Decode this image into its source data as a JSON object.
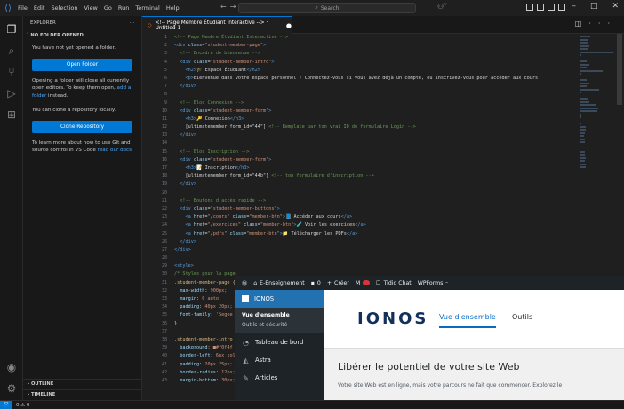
{
  "titlebar": {
    "menus": [
      "File",
      "Edit",
      "Selection",
      "View",
      "Go",
      "Run",
      "Terminal",
      "Help"
    ],
    "search_placeholder": "Search"
  },
  "sidebar": {
    "title": "EXPLORER",
    "section": "NO FOLDER OPENED",
    "no_folder_text": "You have not yet opened a folder.",
    "open_folder_button": "Open Folder",
    "info_text": "Opening a folder will close all currently open editors. To keep them open,",
    "info_link": "add a folder",
    "info_suffix": "instead.",
    "clone_text": "You can clone a repository locally.",
    "clone_button": "Clone Repository",
    "learn_text": "To learn more about how to use Git and source control in VS Code",
    "learn_link": "read our docs",
    "outline": "OUTLINE",
    "timeline": "TIMELINE"
  },
  "status": {
    "problems": "0 ⚠ 0"
  },
  "editor": {
    "tab_title": "<!-- Page Membre Étudiant Interactive --> · Untitled-1",
    "line_numbers": [
      "1",
      "2",
      "3",
      "4",
      "5",
      "6",
      "7",
      "8",
      "9",
      "10",
      "11",
      "12",
      "13",
      "14",
      "15",
      "16",
      "17",
      "18",
      "19",
      "20",
      "21",
      "22",
      "23",
      "24",
      "25",
      "26",
      "27",
      "28",
      "29",
      "30",
      "31",
      "32",
      "33",
      "34",
      "35",
      "36",
      "37",
      "38",
      "39",
      "40",
      "41",
      "42",
      "43"
    ],
    "lines": [
      {
        "parts": [
          {
            "c": "c-com",
            "t": "<!-- Page Membre Étudiant Interactive -->"
          }
        ]
      },
      {
        "parts": [
          {
            "c": "c-tag",
            "t": "<div "
          },
          {
            "c": "c-attr",
            "t": "class"
          },
          {
            "c": "c-txt",
            "t": "="
          },
          {
            "c": "c-str",
            "t": "\"student-member-page\""
          },
          {
            "c": "c-tag",
            "t": ">"
          }
        ]
      },
      {
        "parts": [
          {
            "c": "c-com",
            "t": "  <!-- Encadré de bienvenue -->"
          }
        ]
      },
      {
        "parts": [
          {
            "c": "c-tag",
            "t": "  <div "
          },
          {
            "c": "c-attr",
            "t": "class"
          },
          {
            "c": "c-txt",
            "t": "="
          },
          {
            "c": "c-str",
            "t": "\"student-member-intro\""
          },
          {
            "c": "c-tag",
            "t": ">"
          }
        ]
      },
      {
        "parts": [
          {
            "c": "c-tag",
            "t": "    <h2>"
          },
          {
            "c": "c-txt",
            "t": "🎓 Espace Étudiant"
          },
          {
            "c": "c-tag",
            "t": "</h2>"
          }
        ]
      },
      {
        "parts": [
          {
            "c": "c-tag",
            "t": "    <p>"
          },
          {
            "c": "c-txt",
            "t": "Bienvenue dans votre espace personnel ! Connectez-vous si vous avez déjà un compte, ou inscrivez-vous pour accéder aux cours"
          }
        ]
      },
      {
        "parts": [
          {
            "c": "c-tag",
            "t": "  </div>"
          }
        ]
      },
      {
        "parts": [
          {
            "c": "c-txt",
            "t": ""
          }
        ]
      },
      {
        "parts": [
          {
            "c": "c-com",
            "t": "  <!-- Bloc Connexion -->"
          }
        ]
      },
      {
        "parts": [
          {
            "c": "c-tag",
            "t": "  <div "
          },
          {
            "c": "c-attr",
            "t": "class"
          },
          {
            "c": "c-txt",
            "t": "="
          },
          {
            "c": "c-str",
            "t": "\"student-member-form\""
          },
          {
            "c": "c-tag",
            "t": ">"
          }
        ]
      },
      {
        "parts": [
          {
            "c": "c-tag",
            "t": "    <h3>"
          },
          {
            "c": "c-txt",
            "t": "🔑 Connexion"
          },
          {
            "c": "c-tag",
            "t": "</h3>"
          }
        ]
      },
      {
        "parts": [
          {
            "c": "c-txt",
            "t": "    [ultimatemember form_id=\"44\"] "
          },
          {
            "c": "c-com",
            "t": "<!-- Remplace par ton vrai ID de formulaire Login -->"
          }
        ]
      },
      {
        "parts": [
          {
            "c": "c-tag",
            "t": "  </div>"
          }
        ]
      },
      {
        "parts": [
          {
            "c": "c-txt",
            "t": ""
          }
        ]
      },
      {
        "parts": [
          {
            "c": "c-com",
            "t": "  <!-- Bloc Inscription -->"
          }
        ]
      },
      {
        "parts": [
          {
            "c": "c-tag",
            "t": "  <div "
          },
          {
            "c": "c-attr",
            "t": "class"
          },
          {
            "c": "c-txt",
            "t": "="
          },
          {
            "c": "c-str",
            "t": "\"student-member-form\""
          },
          {
            "c": "c-tag",
            "t": ">"
          }
        ]
      },
      {
        "parts": [
          {
            "c": "c-tag",
            "t": "    <h3>"
          },
          {
            "c": "c-txt",
            "t": "📝 Inscription"
          },
          {
            "c": "c-tag",
            "t": "</h3>"
          }
        ]
      },
      {
        "parts": [
          {
            "c": "c-txt",
            "t": "    [ultimatemember form_id=\"44b\"] "
          },
          {
            "c": "c-com",
            "t": "<!-- ton formulaire d'inscription -->"
          }
        ]
      },
      {
        "parts": [
          {
            "c": "c-tag",
            "t": "  </div>"
          }
        ]
      },
      {
        "parts": [
          {
            "c": "c-txt",
            "t": ""
          }
        ]
      },
      {
        "parts": [
          {
            "c": "c-com",
            "t": "  <!-- Boutons d'accès rapide -->"
          }
        ]
      },
      {
        "parts": [
          {
            "c": "c-tag",
            "t": "  <div "
          },
          {
            "c": "c-attr",
            "t": "class"
          },
          {
            "c": "c-txt",
            "t": "="
          },
          {
            "c": "c-str",
            "t": "\"student-member-buttons\""
          },
          {
            "c": "c-tag",
            "t": ">"
          }
        ]
      },
      {
        "parts": [
          {
            "c": "c-tag",
            "t": "    <a "
          },
          {
            "c": "c-attr",
            "t": "href"
          },
          {
            "c": "c-txt",
            "t": "="
          },
          {
            "c": "c-str",
            "t": "\"/cours\" "
          },
          {
            "c": "c-attr",
            "t": "class"
          },
          {
            "c": "c-txt",
            "t": "="
          },
          {
            "c": "c-str",
            "t": "\"member-btn\""
          },
          {
            "c": "c-tag",
            "t": ">"
          },
          {
            "c": "c-txt",
            "t": "📘 Accéder aux cours"
          },
          {
            "c": "c-tag",
            "t": "</a>"
          }
        ]
      },
      {
        "parts": [
          {
            "c": "c-tag",
            "t": "    <a "
          },
          {
            "c": "c-attr",
            "t": "href"
          },
          {
            "c": "c-txt",
            "t": "="
          },
          {
            "c": "c-str",
            "t": "\"/exercices\" "
          },
          {
            "c": "c-attr",
            "t": "class"
          },
          {
            "c": "c-txt",
            "t": "="
          },
          {
            "c": "c-str",
            "t": "\"member-btn\""
          },
          {
            "c": "c-tag",
            "t": ">"
          },
          {
            "c": "c-txt",
            "t": "🧪 Voir les exercices"
          },
          {
            "c": "c-tag",
            "t": "</a>"
          }
        ]
      },
      {
        "parts": [
          {
            "c": "c-tag",
            "t": "    <a "
          },
          {
            "c": "c-attr",
            "t": "href"
          },
          {
            "c": "c-txt",
            "t": "="
          },
          {
            "c": "c-str",
            "t": "\"/pdfs\" "
          },
          {
            "c": "c-attr",
            "t": "class"
          },
          {
            "c": "c-txt",
            "t": "="
          },
          {
            "c": "c-str",
            "t": "\"member-btn\""
          },
          {
            "c": "c-tag",
            "t": ">"
          },
          {
            "c": "c-txt",
            "t": "📁 Télécharger les PDFs"
          },
          {
            "c": "c-tag",
            "t": "</a>"
          }
        ]
      },
      {
        "parts": [
          {
            "c": "c-tag",
            "t": "  </div>"
          }
        ]
      },
      {
        "parts": [
          {
            "c": "c-tag",
            "t": "</div>"
          }
        ]
      },
      {
        "parts": [
          {
            "c": "c-txt",
            "t": ""
          }
        ]
      },
      {
        "parts": [
          {
            "c": "c-tag",
            "t": "<style>"
          }
        ]
      },
      {
        "parts": [
          {
            "c": "c-com",
            "t": "/* Styles pour la page"
          }
        ]
      },
      {
        "parts": [
          {
            "c": "c-sel",
            "t": ".student-member-page {"
          }
        ]
      },
      {
        "parts": [
          {
            "c": "c-prop",
            "t": "  max-width"
          },
          {
            "c": "c-txt",
            "t": ": "
          },
          {
            "c": "c-str",
            "t": "900px;"
          }
        ]
      },
      {
        "parts": [
          {
            "c": "c-prop",
            "t": "  margin"
          },
          {
            "c": "c-txt",
            "t": ": "
          },
          {
            "c": "c-str",
            "t": "0 auto;"
          }
        ]
      },
      {
        "parts": [
          {
            "c": "c-prop",
            "t": "  padding"
          },
          {
            "c": "c-txt",
            "t": ": "
          },
          {
            "c": "c-str",
            "t": "40px 20px;"
          }
        ]
      },
      {
        "parts": [
          {
            "c": "c-prop",
            "t": "  font-family"
          },
          {
            "c": "c-txt",
            "t": ": "
          },
          {
            "c": "c-str",
            "t": "'Segoe"
          }
        ]
      },
      {
        "parts": [
          {
            "c": "c-txt",
            "t": "}"
          }
        ]
      },
      {
        "parts": [
          {
            "c": "c-txt",
            "t": ""
          }
        ]
      },
      {
        "parts": [
          {
            "c": "c-sel",
            "t": ".student-member-intro"
          }
        ]
      },
      {
        "parts": [
          {
            "c": "c-prop",
            "t": "  background"
          },
          {
            "c": "c-txt",
            "t": ": "
          },
          {
            "c": "c-str",
            "t": "■#f0f4f"
          }
        ]
      },
      {
        "parts": [
          {
            "c": "c-prop",
            "t": "  border-left"
          },
          {
            "c": "c-txt",
            "t": ": "
          },
          {
            "c": "c-str",
            "t": "6px sol"
          }
        ]
      },
      {
        "parts": [
          {
            "c": "c-prop",
            "t": "  padding"
          },
          {
            "c": "c-txt",
            "t": ": "
          },
          {
            "c": "c-str",
            "t": "20px 25px;"
          }
        ]
      },
      {
        "parts": [
          {
            "c": "c-prop",
            "t": "  border-radius"
          },
          {
            "c": "c-txt",
            "t": ": "
          },
          {
            "c": "c-str",
            "t": "12px;"
          }
        ]
      },
      {
        "parts": [
          {
            "c": "c-prop",
            "t": "  margin-bottom"
          },
          {
            "c": "c-txt",
            "t": ": "
          },
          {
            "c": "c-str",
            "t": "30px;"
          }
        ]
      }
    ]
  },
  "wordpress": {
    "adminbar": {
      "site_name": "E-Enseignement",
      "comments": "0",
      "new_label": "Créer",
      "tidio": "Tidio Chat",
      "wpforms": "WPForms"
    },
    "menu": {
      "ionos": "IONOS",
      "sub_overview": "Vue d'ensemble",
      "sub_tools": "Outils et sécurité",
      "dashboard": "Tableau de bord",
      "astra": "Astra",
      "articles": "Articles"
    },
    "ionos_logo": "IONOS",
    "tabs": [
      "Vue d'ensemble",
      "Outils"
    ],
    "heading": "Libérer le potentiel de votre site Web",
    "desc": "Votre site Web est en ligne, mais votre parcours ne fait que commencer. Explorez le"
  }
}
